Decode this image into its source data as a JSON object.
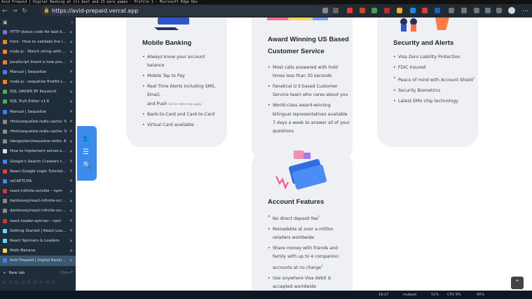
{
  "window": {
    "title": "Avid Prepaid | Digital Banking at its best and 23 more pages - Profile 1 - Microsoft Edge Dev"
  },
  "toolbar": {
    "url": "https://avid-prepaid.vercel.app"
  },
  "sidebar": {
    "tabs": [
      {
        "label": "HTTP status code for bad data",
        "color": "#7c6ff0"
      },
      {
        "label": "html - How to validate the length",
        "color": "#f48024"
      },
      {
        "label": "node.js - Match string with values",
        "color": "#f48024"
      },
      {
        "label": "JavaScript insert a new property",
        "color": "#f48024"
      },
      {
        "label": "Manual | Sequelize",
        "color": "#3b82f6"
      },
      {
        "label": "node.js - sequelize findAll sort",
        "color": "#f48024"
      },
      {
        "label": "SQL ORDER BY Keyword",
        "color": "#4caf50"
      },
      {
        "label": "SQL TryIt Editor v1.6",
        "color": "#4caf50"
      },
      {
        "label": "Manual | Sequelize",
        "color": "#3b82f6"
      },
      {
        "label": "rfink/sequelize-redis-cache: S",
        "color": "#8a8a8a"
      },
      {
        "label": "rfink/sequelize-redis-cache: S",
        "color": "#8a8a8a"
      },
      {
        "label": "idangozlan/sequelize-redis: A",
        "color": "#8a8a8a"
      },
      {
        "label": "How to implement server-side",
        "color": "#e0e0e0"
      },
      {
        "label": "Google's Search Crawlers to fe",
        "color": "#4285f4"
      },
      {
        "label": "React Google Login Tutorial: U",
        "color": "#e53935"
      },
      {
        "label": "reCAPTCHA",
        "color": "#4285f4"
      },
      {
        "label": "react-infinite-scroller - npm",
        "color": "#cb3837"
      },
      {
        "label": "danbovey/react-infinite-scroller",
        "color": "#8a8a8a"
      },
      {
        "label": "danbovey/react-infinite-scroller",
        "color": "#8a8a8a"
      },
      {
        "label": "react-loader-spinner - npm",
        "color": "#cb3837"
      },
      {
        "label": "Getting Started | React Loader",
        "color": "#61dafb"
      },
      {
        "label": "React Spinners & Loaders",
        "color": "#61dafb"
      },
      {
        "label": "Math Banana",
        "color": "#fdd835"
      },
      {
        "label": "Avid Prepaid | Digital Banking",
        "color": "#3b82f6"
      }
    ],
    "new_tab_label": "New tab",
    "new_tab_shortcut": "Ctrl+T"
  },
  "cards": {
    "mobile": {
      "title": "Mobile Banking",
      "items": [
        "Always know your account balance",
        "Mobile Tap to Pay",
        "Real Time Alerts including SMS, Email,",
        "Bank-to-Card and Card-to-Card",
        "Virtual Card available"
      ],
      "item2_cont": "and Push",
      "item2_note": "Carrier rates may apply"
    },
    "service": {
      "title_line1": "Award Winning US Based",
      "title_line2": "Customer Service",
      "items": [
        "Most calls answered with hold times less than 30 seconds",
        "Fanatical U.S based Customer Service team who cares about you",
        "World-class award-winning bilingual representatives available 7 days a week to answer all of your questions"
      ]
    },
    "security": {
      "title": "Security and Alerts",
      "items": [
        "Visa Zero Liability Protection",
        "FDIC Insured",
        "Peace of mind with Account Shield",
        "Security Biometrics",
        "Latest EMV chip technology"
      ],
      "item3_sup": "3"
    },
    "account": {
      "title": "Account Features",
      "items": [
        "No direct deposit fee",
        "Reloadable at over a million retailers worldwide",
        "Share money with friends and family with up to 4 companion accounts at no charge",
        "Use anywhere Visa debit is accepted worldwide"
      ],
      "item1_sup": "2",
      "item3_sup": "4"
    }
  },
  "taskbar": {
    "time": "18:27",
    "net": "mubeat",
    "battery": "51%",
    "cpu": "CPU 9%",
    "mem": "90%"
  },
  "icons": [
    "users-icon",
    "list-icon",
    "search-icon",
    "chevron-up-icon"
  ],
  "colors": {
    "accent": "#3b8beb",
    "card_bg": "#eef0f3",
    "sidebar_bg": "#1f2d3a"
  }
}
